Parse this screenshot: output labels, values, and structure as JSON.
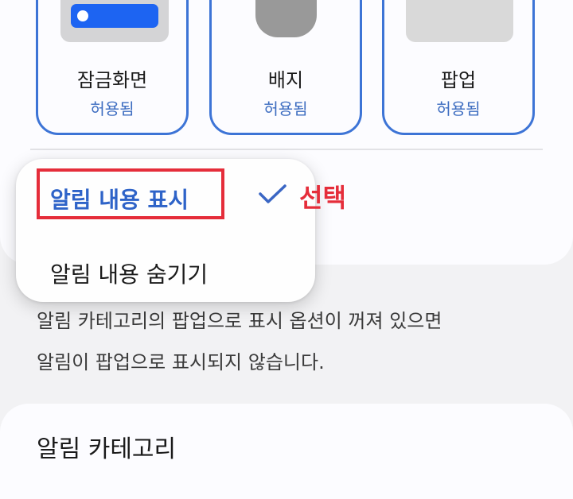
{
  "notification_styles": [
    {
      "label": "잠금화면",
      "status": "허용됨",
      "preview": "lockscreen-preview"
    },
    {
      "label": "배지",
      "status": "허용됨",
      "preview": "badge-preview"
    },
    {
      "label": "팝업",
      "status": "허용됨",
      "preview": "popup-preview"
    }
  ],
  "content_dropdown": {
    "options": [
      "알림 내용 표시",
      "알림 내용 숨기기"
    ],
    "selected_index": 0
  },
  "annotation": {
    "label": "선택",
    "color": "#e52d3a"
  },
  "description": {
    "lines": [
      "알림 카테고리의 팝업으로 표시 옵션이 꺼져 있으면",
      "알림이 팝업으로 표시되지 않습니다."
    ]
  },
  "category_section": {
    "title": "알림 카테고리"
  },
  "colors": {
    "accent": "#3d74d6",
    "status_text": "#3c6cc0",
    "annotation": "#e52d3a",
    "toggle_bar": "#1d64f2"
  }
}
